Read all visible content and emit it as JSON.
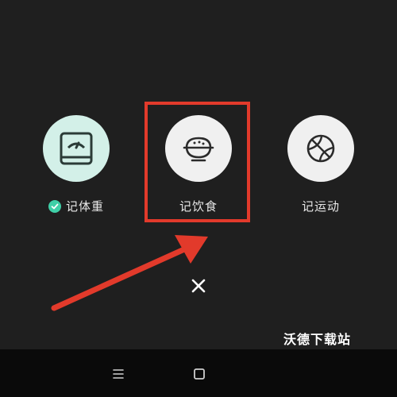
{
  "actions": [
    {
      "label": "记体重",
      "icon": "scale-icon",
      "checked": true
    },
    {
      "label": "记饮食",
      "icon": "food-bowl-icon",
      "checked": false
    },
    {
      "label": "记运动",
      "icon": "basketball-icon",
      "checked": false
    }
  ],
  "close": {
    "icon": "close-icon",
    "glyph": "✕"
  },
  "watermark": "沃德下载站",
  "navbar": {
    "menu_icon": "menu-icon",
    "home_icon": "home-icon"
  },
  "colors": {
    "background": "#1f1f1f",
    "weight_circle": "#d3f0e8",
    "icon_circle": "#f0f0f0",
    "check_green": "#3fcfa7",
    "annotation_red": "#e23a2b",
    "navbar": "#0a0a0a"
  }
}
